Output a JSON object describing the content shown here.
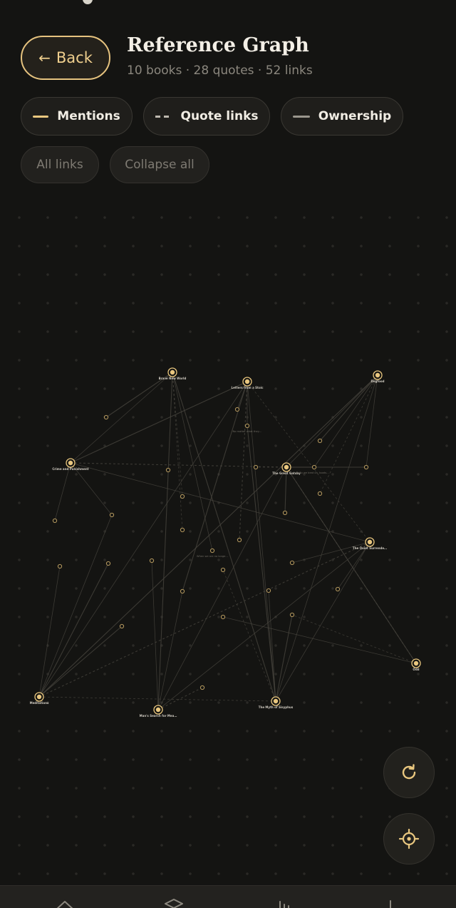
{
  "header": {
    "back_label": "Back",
    "title": "Reference Graph",
    "subtitle": "10 books · 28 quotes · 52 links"
  },
  "legend": {
    "mentions": "Mentions",
    "quote_links": "Quote links",
    "ownership": "Ownership"
  },
  "filters": {
    "all_links": "All links",
    "collapse_all": "Collapse all"
  },
  "colors": {
    "accent": "#e9c77f",
    "background": "#141412",
    "edge": "#4a4740"
  },
  "graph": {
    "books": [
      {
        "label": "Brave New World"
      },
      {
        "label": "Letters from a Stoic"
      },
      {
        "label": "Dogfood"
      },
      {
        "label": "Crime and Punishment"
      },
      {
        "label": "The Great Gatsby"
      },
      {
        "label": "The Quiet Surrende…"
      },
      {
        "label": "Odd"
      },
      {
        "label": "Meditations"
      },
      {
        "label": "Man's Search for Mea…"
      },
      {
        "label": "The Myth of Sisyphus"
      }
    ],
    "quote_labels": [
      {
        "label": "No matter what they…"
      },
      {
        "label": "So we beat on, boats…"
      },
      {
        "label": "When we are no longe…"
      }
    ]
  },
  "fabs": {
    "refresh_icon": "refresh-icon",
    "locate_icon": "crosshair-icon"
  },
  "nav": {
    "home_icon": "home-icon",
    "layers_icon": "layers-icon",
    "chart_icon": "chart-icon",
    "profile_icon": "profile-icon"
  }
}
